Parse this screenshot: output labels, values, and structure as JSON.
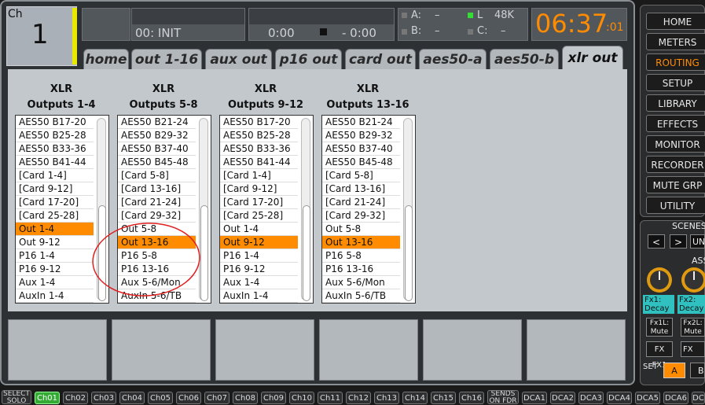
{
  "channel": {
    "label": "Ch",
    "number": "1"
  },
  "header": {
    "scene": "00: INIT",
    "time_left": "0:00",
    "time_right": "- 0:00",
    "meter_a_label": "A:",
    "meter_a_value": "–",
    "meter_b_label": "B:",
    "meter_b_value": "–",
    "meter_l_label": "L",
    "meter_l_value": "48K",
    "meter_c_label": "C:",
    "meter_c_value": "–",
    "clock": "06:37",
    "clock_seconds": ":01"
  },
  "tabs": [
    "home",
    "out 1-16",
    "aux out",
    "p16 out",
    "card out",
    "aes50-a",
    "aes50-b",
    "xlr out"
  ],
  "groups": [
    {
      "title1": "XLR",
      "title2": "Outputs 1-4",
      "items": [
        "AES50 B17-20",
        "AES50 B25-28",
        "AES50 B33-36",
        "AES50 B41-44",
        "[Card 1-4]",
        "[Card 9-12]",
        "[Card 17-20]",
        "[Card 25-28]",
        "Out 1-4",
        "Out 9-12",
        "P16 1-4",
        "P16 9-12",
        "Aux 1-4",
        "AuxIn 1-4"
      ],
      "selected": 8
    },
    {
      "title1": "XLR",
      "title2": "Outputs 5-8",
      "items": [
        "AES50 B21-24",
        "AES50 B29-32",
        "AES50 B37-40",
        "AES50 B45-48",
        "[Card 5-8]",
        "[Card 13-16]",
        "[Card 21-24]",
        "[Card 29-32]",
        "Out 5-8",
        "Out 13-16",
        "P16 5-8",
        "P16 13-16",
        "Aux 5-6/Mon",
        "AuxIn 5-6/TB"
      ],
      "selected": 9
    },
    {
      "title1": "XLR",
      "title2": "Outputs 9-12",
      "items": [
        "AES50 B17-20",
        "AES50 B25-28",
        "AES50 B33-36",
        "AES50 B41-44",
        "[Card 1-4]",
        "[Card 9-12]",
        "[Card 17-20]",
        "[Card 25-28]",
        "Out 1-4",
        "Out 9-12",
        "P16 1-4",
        "P16 9-12",
        "Aux 1-4",
        "AuxIn 1-4"
      ],
      "selected": 9
    },
    {
      "title1": "XLR",
      "title2": "Outputs 13-16",
      "items": [
        "AES50 B21-24",
        "AES50 B29-32",
        "AES50 B37-40",
        "AES50 B45-48",
        "[Card 5-8]",
        "[Card 13-16]",
        "[Card 21-24]",
        "[Card 29-32]",
        "Out 5-8",
        "Out 13-16",
        "P16 5-8",
        "P16 13-16",
        "Aux 5-6/Mon",
        "AuxIn 5-6/TB"
      ],
      "selected": 9
    }
  ],
  "sidebar": {
    "buttons": [
      "HOME",
      "METERS",
      "ROUTING",
      "SETUP",
      "LIBRARY",
      "EFFECTS",
      "MONITOR",
      "RECORDER",
      "MUTE GRP",
      "UTILITY"
    ],
    "active": 2,
    "scenes_label": "SCENES",
    "scene_prev": "<",
    "scene_next": ">",
    "scene_undo": "UN",
    "assign_label": "ASS",
    "fx1_name": "Fx1:",
    "fx1_param": "Decay",
    "fx2_name": "Fx2:",
    "fx2_param": "Decay",
    "fx1l_label": "Fx1L:",
    "fx1l_mute": "Mute",
    "fx2l_label": "Fx2L:",
    "fx2l_mute": "Mute",
    "fxfx1": "FX FX1",
    "fxfx2": "FX FX",
    "set_label": "SET",
    "set_a": "A",
    "set_b": "B"
  },
  "channel_strip": {
    "select_label": "SELECT",
    "select_sub": "SOLO",
    "channels": [
      "Ch01",
      "Ch02",
      "Ch03",
      "Ch04",
      "Ch05",
      "Ch06",
      "Ch07",
      "Ch08",
      "Ch09",
      "Ch10",
      "Ch11",
      "Ch12",
      "Ch13",
      "Ch14",
      "Ch15",
      "Ch16"
    ],
    "sends_label": "SENDS",
    "sends_sub": "ON FDR",
    "dcas": [
      "DCA1",
      "DCA2",
      "DCA3",
      "DCA4",
      "DCA5",
      "DCA6",
      "DC"
    ]
  },
  "colors": {
    "selected": "#ff8c00",
    "clock": "#ff8c00",
    "meter_green": "#33dd33",
    "channel_bar": "#e8e800"
  }
}
